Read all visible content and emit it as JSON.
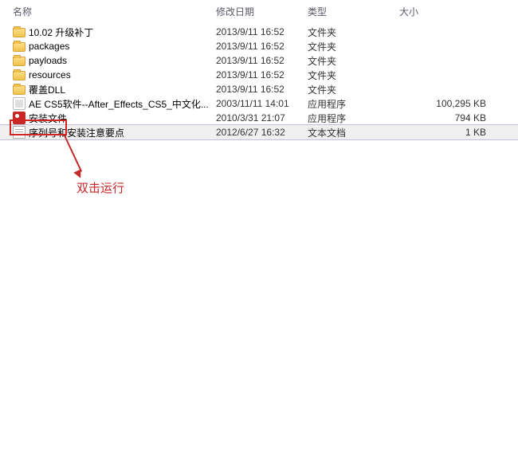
{
  "columns": {
    "name": "名称",
    "date": "修改日期",
    "type": "类型",
    "size": "大小"
  },
  "files": [
    {
      "icon": "folder",
      "name": "10.02 升级补丁",
      "date": "2013/9/11 16:52",
      "type": "文件夹",
      "size": ""
    },
    {
      "icon": "folder",
      "name": "packages",
      "date": "2013/9/11 16:52",
      "type": "文件夹",
      "size": ""
    },
    {
      "icon": "folder",
      "name": "payloads",
      "date": "2013/9/11 16:52",
      "type": "文件夹",
      "size": ""
    },
    {
      "icon": "folder",
      "name": "resources",
      "date": "2013/9/11 16:52",
      "type": "文件夹",
      "size": ""
    },
    {
      "icon": "folder",
      "name": "覆盖DLL",
      "date": "2013/9/11 16:52",
      "type": "文件夹",
      "size": ""
    },
    {
      "icon": "app",
      "name": "AE CS5软件--After_Effects_CS5_中文化...",
      "date": "2003/11/11 14:01",
      "type": "应用程序",
      "size": "100,295 KB"
    },
    {
      "icon": "redapp",
      "name": "安装文件",
      "date": "2010/3/31 21:07",
      "type": "应用程序",
      "size": "794 KB",
      "highlighted": true
    },
    {
      "icon": "txt",
      "name": "序列号和安装注意要点",
      "date": "2012/6/27 16:32",
      "type": "文本文档",
      "size": "1 KB",
      "selected": true
    }
  ],
  "annotation": {
    "text": "双击运行"
  }
}
